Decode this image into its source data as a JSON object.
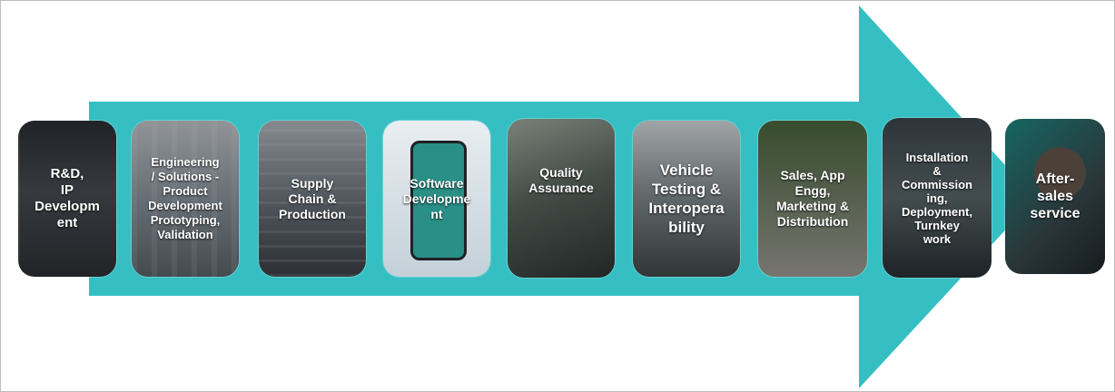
{
  "colors": {
    "arrow": "#36bfc3",
    "label_text": "#ffffff",
    "frame_border": "#bdbdbd"
  },
  "stages": [
    {
      "label": "R&D,\nIP\nDevelopm\nent",
      "image": "server-rack-lab"
    },
    {
      "label": "Engineering\n/ Solutions -\nProduct\nDevelopment\nPrototyping,\nValidation",
      "image": "engineering-workbench"
    },
    {
      "label": "Supply\nChain &\nProduction",
      "image": "production-line"
    },
    {
      "label": "Software\nDevelopme\nnt",
      "image": "smartphone-dashboard"
    },
    {
      "label": "Quality\nAssurance",
      "image": "charger-testing"
    },
    {
      "label": "Vehicle\nTesting &\nInteropera\nbility",
      "image": "ev-charging-station"
    },
    {
      "label": "Sales, App\nEngg,\nMarketing &\nDistribution",
      "image": "sales-team-outdoors"
    },
    {
      "label": "Installation\n&\nCommission\ning,\nDeployment,\nTurnkey\nwork",
      "image": "installed-charger"
    },
    {
      "label": "After-\nsales\nservice",
      "image": "support-agent-headset"
    }
  ]
}
